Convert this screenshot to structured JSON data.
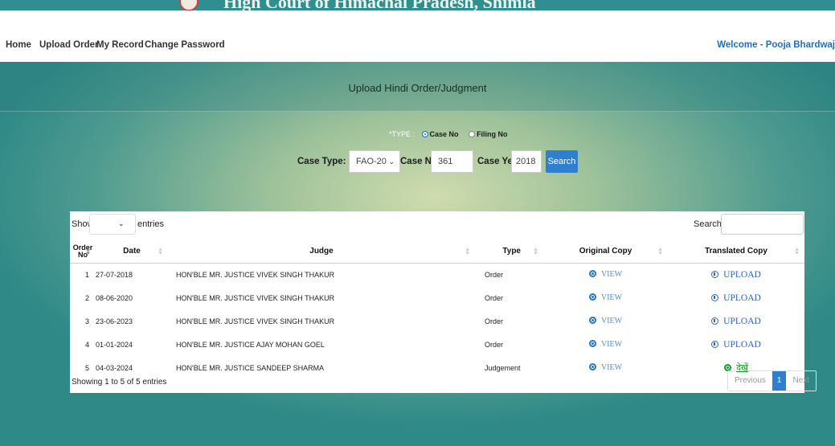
{
  "banner": {
    "title": "High Court of Himachal Pradesh, Shimla"
  },
  "nav": {
    "items": [
      "Home",
      "Upload Order",
      "My Record",
      "Change Password"
    ],
    "welcome": "Welcome - Pooja Bhardwaj"
  },
  "page": {
    "title": "Upload Hindi Order/Judgment"
  },
  "form": {
    "type_label": "*TYPE :",
    "type_options": [
      "Case No",
      "Filing No"
    ],
    "type_selected": "Case No",
    "case_type_label": "Case Type:",
    "case_type_value": "FAO-20",
    "case_no_label": "Case No:",
    "case_no_value": "361",
    "case_year_label": "Case Year:",
    "case_year_value": "2018",
    "search_label": "Search"
  },
  "table": {
    "show_label": "Show",
    "entries_label": "entries",
    "search_label": "Search:",
    "headers": [
      "Order No",
      "Date",
      "Judge",
      "Type",
      "Original Copy",
      "Translated Copy"
    ],
    "rows": [
      {
        "no": "1",
        "date": "27-07-2018",
        "judge": "HON'BLE MR. JUSTICE VIVEK SINGH THAKUR",
        "type": "Order",
        "original": "VIEW",
        "translated": "UPLOAD"
      },
      {
        "no": "2",
        "date": "08-06-2020",
        "judge": "HON'BLE MR. JUSTICE VIVEK SINGH THAKUR",
        "type": "Order",
        "original": "VIEW",
        "translated": "UPLOAD"
      },
      {
        "no": "3",
        "date": "23-06-2023",
        "judge": "HON'BLE MR. JUSTICE VIVEK SINGH THAKUR",
        "type": "Order",
        "original": "VIEW",
        "translated": "UPLOAD"
      },
      {
        "no": "4",
        "date": "01-01-2024",
        "judge": "HON'BLE MR. JUSTICE AJAY MOHAN GOEL",
        "type": "Order",
        "original": "VIEW",
        "translated": "UPLOAD"
      },
      {
        "no": "5",
        "date": "04-03-2024",
        "judge": "HON'BLE MR. JUSTICE SANDEEP SHARMA",
        "type": "Judgement",
        "original": "VIEW",
        "translated": "देखें"
      }
    ],
    "info": "Showing 1 to 5 of 5 entries",
    "pager": {
      "previous": "Previous",
      "current": "1",
      "next": "Next"
    }
  },
  "colors": {
    "accent": "#2f7fcf",
    "welcome": "#1f6fc0",
    "hindi_link": "#1d9a2f"
  }
}
